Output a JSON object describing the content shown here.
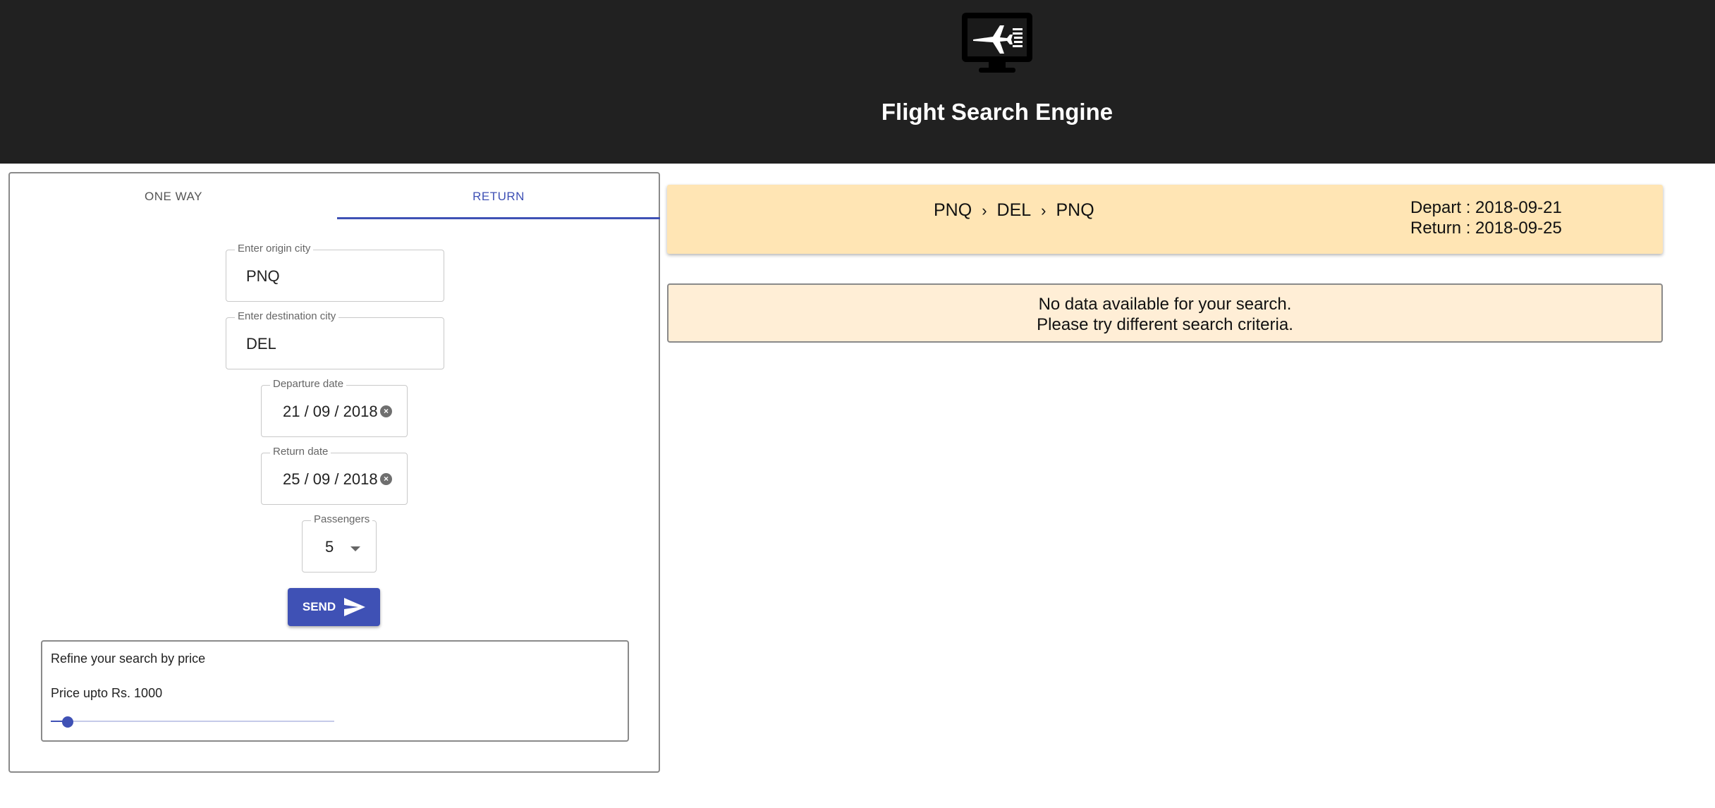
{
  "header": {
    "title": "Flight Search Engine",
    "logo_icon": "airplane-monitor-icon"
  },
  "tabs": [
    {
      "label": "ONE WAY",
      "active": false
    },
    {
      "label": "RETURN",
      "active": true
    }
  ],
  "form": {
    "origin": {
      "label": "Enter origin city",
      "value": "PNQ"
    },
    "destination": {
      "label": "Enter destination city",
      "value": "DEL"
    },
    "departure": {
      "label": "Departure date",
      "value": "21 / 09 / 2018"
    },
    "return": {
      "label": "Return date",
      "value": "25 / 09 / 2018"
    },
    "passengers": {
      "label": "Passengers",
      "value": "5"
    },
    "send_label": "SEND"
  },
  "refine": {
    "title": "Refine your search by price",
    "price_label": "Price upto Rs. 1000",
    "slider_fraction": 0.06
  },
  "summary": {
    "route": [
      "PNQ",
      "DEL",
      "PNQ"
    ],
    "depart": "Depart : 2018-09-21",
    "return": "Return : 2018-09-25"
  },
  "message": {
    "line1": "No data available for your search.",
    "line2": "Please try different search criteria."
  },
  "colors": {
    "header_bg": "#212121",
    "accent": "#3f51b5",
    "summary_bg": "#ffe5b4",
    "message_bg": "#ffeed6"
  }
}
